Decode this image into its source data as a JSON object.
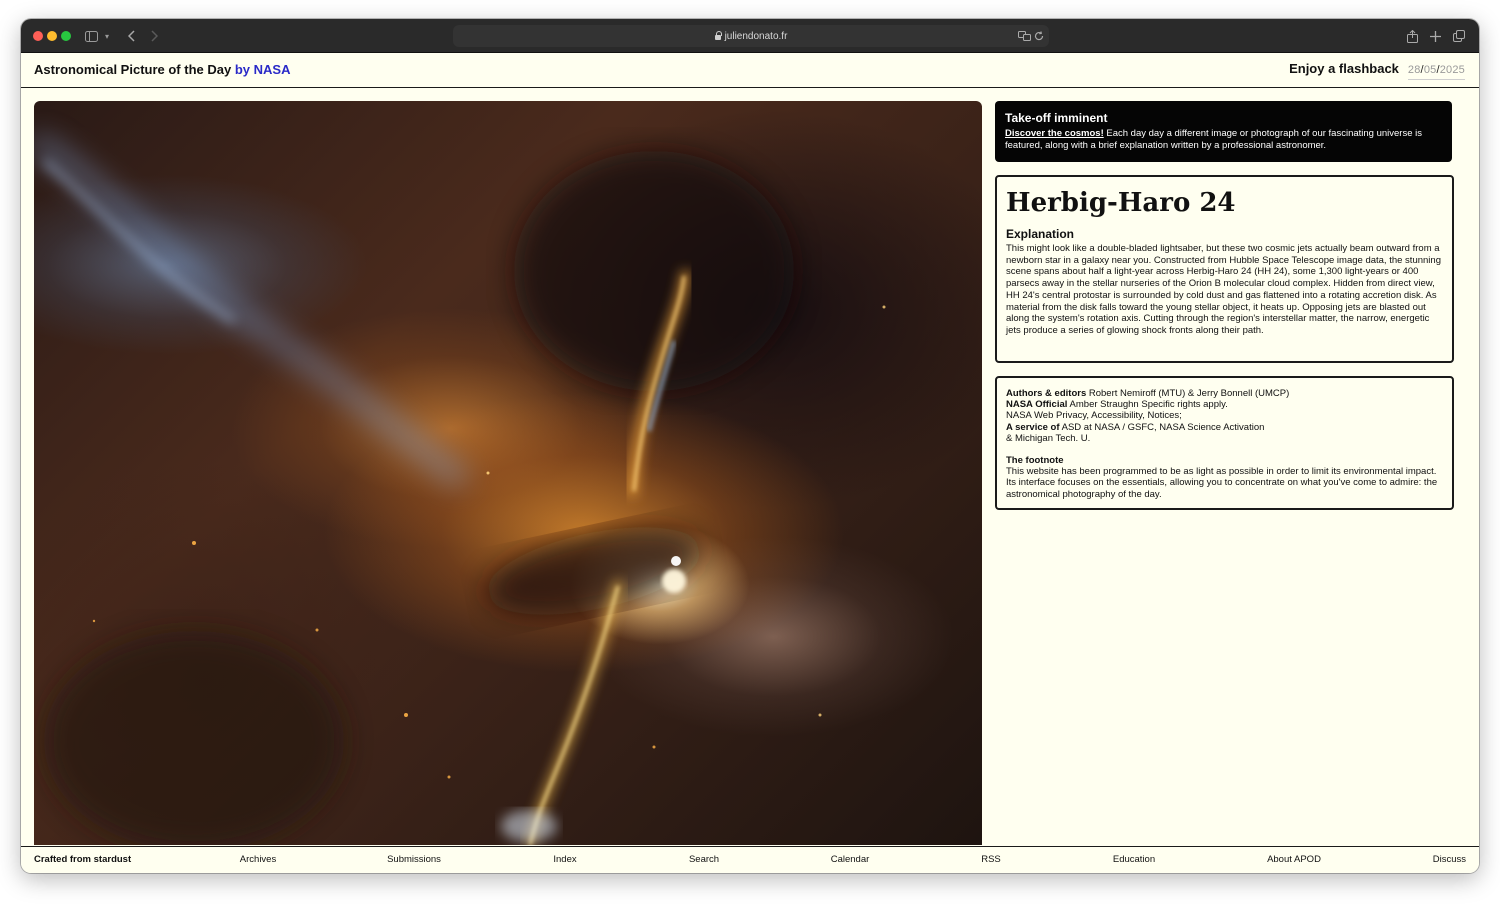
{
  "browser": {
    "url": "juliendonato.fr"
  },
  "header": {
    "title_main": "Astronomical Picture of the Day",
    "title_by": "by NASA",
    "flashback_label": "Enjoy a flashback",
    "date_day": "28",
    "date_month": "05",
    "date_year": "2025",
    "date_separator": "/"
  },
  "hero": {
    "alt": "Herbig-Haro 24 jets image"
  },
  "banner": {
    "title": "Take-off imminent",
    "link": "Discover the cosmos!",
    "text": " Each day day a different image or photograph of our fascinating universe is featured, along with a brief explanation written by a professional astronomer."
  },
  "article": {
    "title": "Herbig-Haro 24",
    "explanation_heading": "Explanation",
    "explanation": "This might look like a double-bladed lightsaber, but these two cosmic jets actually beam outward from a newborn star in a galaxy near you. Constructed from Hubble Space Telescope image data, the stunning scene spans about half a light-year across Herbig-Haro 24 (HH 24), some 1,300 light-years or 400 parsecs away in the stellar nurseries of the Orion B molecular cloud complex. Hidden from direct view, HH 24's central protostar is surrounded by cold dust and gas flattened into a rotating accretion disk. As material from the disk falls toward the young stellar object, it heats up. Opposing jets are blasted out along the system's rotation axis. Cutting through the region's interstellar matter, the narrow, energetic jets produce a series of glowing shock fronts along their path."
  },
  "credits": {
    "authors_label": "Authors & editors",
    "authors_value": " Robert Nemiroff (MTU) & Jerry Bonnell (UMCP)",
    "official_label": "NASA Official",
    "official_value": " Amber Straughn Specific rights apply.",
    "privacy_line": "NASA Web Privacy, Accessibility, Notices;",
    "service_label": "A service of",
    "service_value": " ASD at NASA / GSFC, NASA Science Activation",
    "service_line2": "& Michigan Tech. U.",
    "footnote_title": "The footnote",
    "footnote_text": "This website has been programmed to be as light as possible in order to limit its environmental impact. Its interface focuses on the essentials, allowing you to concentrate on what you've come to admire: the astronomical photography of the day."
  },
  "footer": {
    "items": [
      "Crafted from stardust",
      "Archives",
      "Submissions",
      "Index",
      "Search",
      "Calendar",
      "RSS",
      "Education",
      "About APOD",
      "Discuss"
    ]
  }
}
